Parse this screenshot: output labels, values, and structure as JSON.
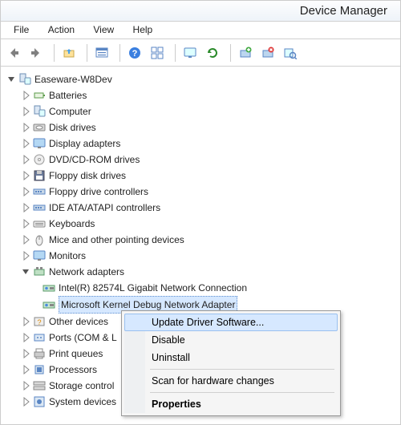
{
  "window": {
    "title": "Device Manager"
  },
  "menus": {
    "file": "File",
    "action": "Action",
    "view": "View",
    "help": "Help"
  },
  "toolbar_icons": [
    "back",
    "forward",
    "up-folder",
    "window-list",
    "help",
    "tile",
    "monitor",
    "refresh",
    "add-hw",
    "remove-hw",
    "scan"
  ],
  "tree": {
    "root": "Easeware-W8Dev",
    "items": [
      {
        "key": "batteries",
        "label": "Batteries",
        "expanded": false
      },
      {
        "key": "computer",
        "label": "Computer",
        "expanded": false
      },
      {
        "key": "disk",
        "label": "Disk drives",
        "expanded": false
      },
      {
        "key": "display",
        "label": "Display adapters",
        "expanded": false
      },
      {
        "key": "dvd",
        "label": "DVD/CD-ROM drives",
        "expanded": false
      },
      {
        "key": "fdd",
        "label": "Floppy disk drives",
        "expanded": false
      },
      {
        "key": "fdc",
        "label": "Floppy drive controllers",
        "expanded": false
      },
      {
        "key": "ide",
        "label": "IDE ATA/ATAPI controllers",
        "expanded": false
      },
      {
        "key": "keyboards",
        "label": "Keyboards",
        "expanded": false
      },
      {
        "key": "mice",
        "label": "Mice and other pointing devices",
        "expanded": false
      },
      {
        "key": "monitors",
        "label": "Monitors",
        "expanded": false
      },
      {
        "key": "network",
        "label": "Network adapters",
        "expanded": true,
        "children": [
          {
            "key": "nic-intel",
            "label": "Intel(R) 82574L Gigabit Network Connection"
          },
          {
            "key": "nic-msdebug",
            "label": "Microsoft Kernel Debug Network Adapter",
            "selected": true
          }
        ]
      },
      {
        "key": "other",
        "label": "Other devices",
        "expanded": false,
        "truncated": true
      },
      {
        "key": "ports",
        "label": "Ports (COM & L",
        "expanded": false,
        "truncated": true
      },
      {
        "key": "printq",
        "label": "Print queues",
        "expanded": false
      },
      {
        "key": "cpu",
        "label": "Processors",
        "expanded": false
      },
      {
        "key": "storage",
        "label": "Storage control",
        "expanded": false,
        "truncated": true
      },
      {
        "key": "system",
        "label": "System devices",
        "expanded": false,
        "truncated": true
      }
    ]
  },
  "context_menu": {
    "update": "Update Driver Software...",
    "disable": "Disable",
    "uninstall": "Uninstall",
    "scan": "Scan for hardware changes",
    "properties": "Properties"
  }
}
